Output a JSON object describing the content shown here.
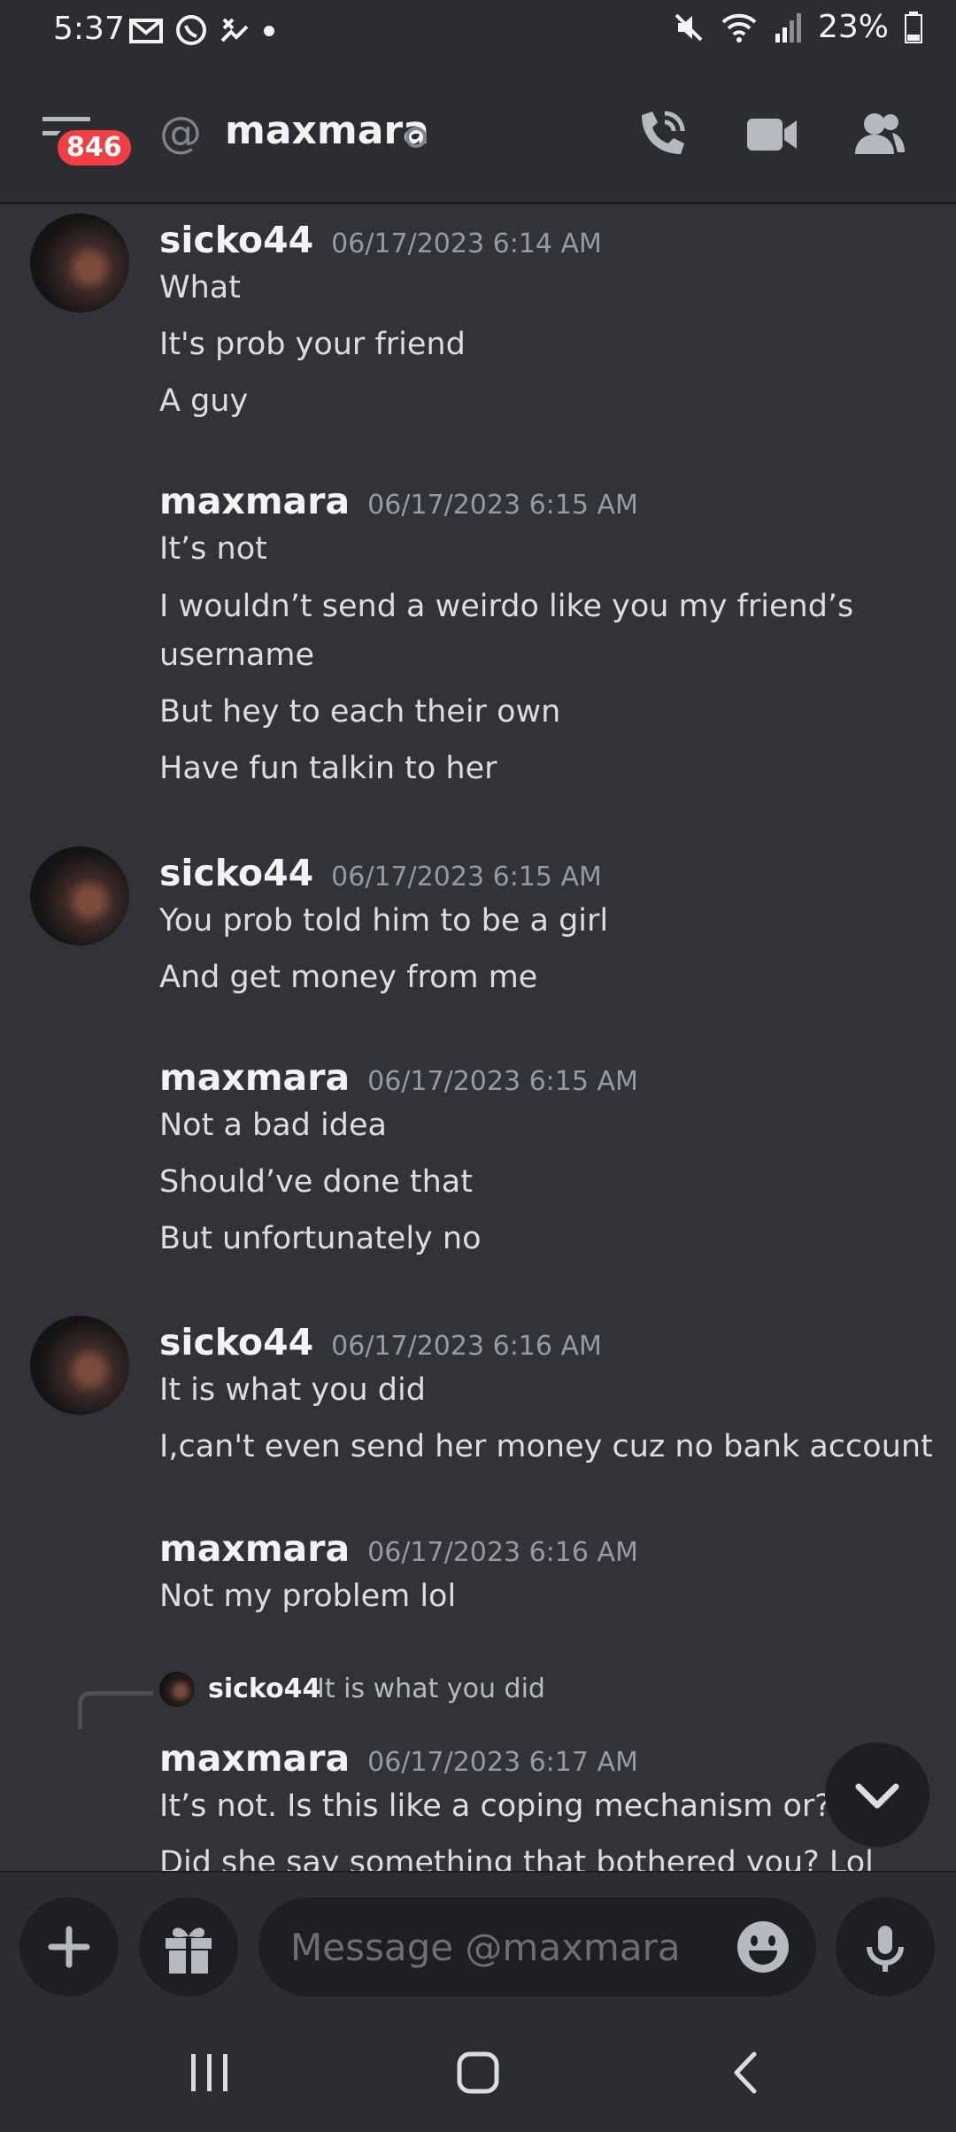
{
  "status_bar": {
    "time": "5:37",
    "battery": "23%"
  },
  "header": {
    "unread_count": "846",
    "channel_name": "maxmara"
  },
  "messages": [
    {
      "author": "sicko44",
      "timestamp": "06/17/2023 6:14 AM",
      "lines": [
        "What",
        "It's prob your friend",
        "A guy"
      ]
    },
    {
      "author": "maxmara",
      "timestamp": "06/17/2023 6:15 AM",
      "lines": [
        "It’s not",
        "I wouldn’t send a weirdo like you my friend’s",
        "username",
        "But hey to each their own",
        "Have fun talkin to her"
      ]
    },
    {
      "author": "sicko44",
      "timestamp": "06/17/2023 6:15 AM",
      "lines": [
        "You prob told him to be a girl",
        "And get money from me"
      ]
    },
    {
      "author": "maxmara",
      "timestamp": "06/17/2023 6:15 AM",
      "lines": [
        "Not a bad idea",
        "Should’ve done that",
        "But unfortunately no"
      ]
    },
    {
      "author": "sicko44",
      "timestamp": "06/17/2023 6:16 AM",
      "lines": [
        "It is what you did",
        "I,can't even send her money cuz no bank account"
      ]
    },
    {
      "author": "maxmara",
      "timestamp": "06/17/2023 6:16 AM",
      "lines": [
        "Not my problem lol"
      ]
    },
    {
      "author": "maxmara",
      "timestamp": "06/17/2023 6:17 AM",
      "lines": [
        "It’s not. Is this like a coping mechanism or??",
        "Did she say something that bothered you? Lol"
      ]
    }
  ],
  "reply": {
    "author": "sicko44",
    "text": "It is what you did"
  },
  "composer": {
    "placeholder": "Message @maxmara"
  }
}
